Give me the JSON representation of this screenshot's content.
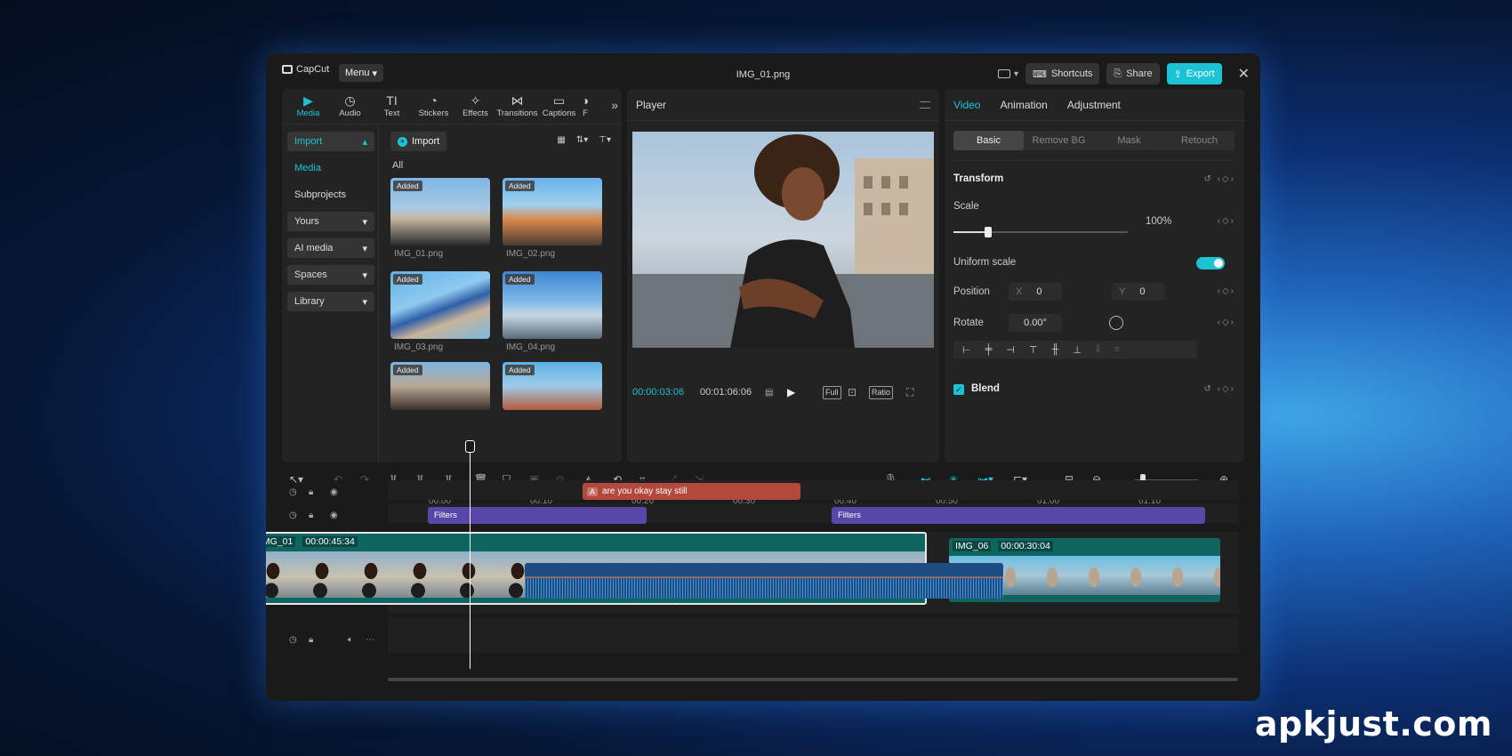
{
  "app": {
    "logo_text": "CapCut",
    "menu_label": "Menu",
    "file_title": "IMG_01.png"
  },
  "titlebar": {
    "shortcuts": "Shortcuts",
    "share": "Share",
    "export": "Export"
  },
  "media_tabs": [
    {
      "label": "Media",
      "icon": "media-icon"
    },
    {
      "label": "Audio",
      "icon": "audio-icon"
    },
    {
      "label": "Text",
      "icon": "text-icon"
    },
    {
      "label": "Stickers",
      "icon": "stickers-icon"
    },
    {
      "label": "Effects",
      "icon": "effects-icon"
    },
    {
      "label": "Transitions",
      "icon": "transitions-icon"
    },
    {
      "label": "Captions",
      "icon": "captions-icon"
    },
    {
      "label": "F",
      "icon": "filters-icon"
    }
  ],
  "side_nav": {
    "import": "Import",
    "media": "Media",
    "subprojects": "Subprojects",
    "yours": "Yours",
    "ai_media": "AI media",
    "spaces": "Spaces",
    "library": "Library"
  },
  "media_panel": {
    "import_button": "Import",
    "all_label": "All",
    "added_badge": "Added",
    "files": [
      "IMG_01.png",
      "IMG_02.png",
      "IMG_03.png",
      "IMG_04.png"
    ]
  },
  "player": {
    "title": "Player",
    "current_time": "00:00:03:06",
    "duration": "00:01:06:06",
    "full": "Full",
    "ratio": "Ratio"
  },
  "props": {
    "tabs": [
      "Video",
      "Animation",
      "Adjustment"
    ],
    "segments": [
      "Basic",
      "Remove BG",
      "Mask",
      "Retouch"
    ],
    "transform": "Transform",
    "scale_label": "Scale",
    "scale_value": "100%",
    "scale_fraction": 0.2,
    "uniform_scale": "Uniform scale",
    "position_label": "Position",
    "pos_x_axis": "X",
    "pos_x": "0",
    "pos_y_axis": "Y",
    "pos_y": "0",
    "rotate_label": "Rotate",
    "rotate_value": "0.00°",
    "blend": "Blend"
  },
  "ruler": [
    "00:00",
    "00:10",
    "00:20",
    "00:30",
    "00:40",
    "00:50",
    "01:00",
    "01:10"
  ],
  "timeline": {
    "text_clip_tag": "A",
    "text_clip": "are you okay stay still",
    "filter_label": "Filters",
    "main_clip_name": "IMG_01",
    "main_clip_duration": "00:00:45:34",
    "second_clip_name": "IMG_06",
    "second_clip_duration": "00:00:30:04"
  },
  "watermark": "apkjust.com",
  "colors": {
    "accent": "#1cc3d4",
    "text_clip": "#b2493c",
    "filter_clip": "#5847a8",
    "video_clip": "#0f6560",
    "audio_clip": "#1d4d82"
  }
}
